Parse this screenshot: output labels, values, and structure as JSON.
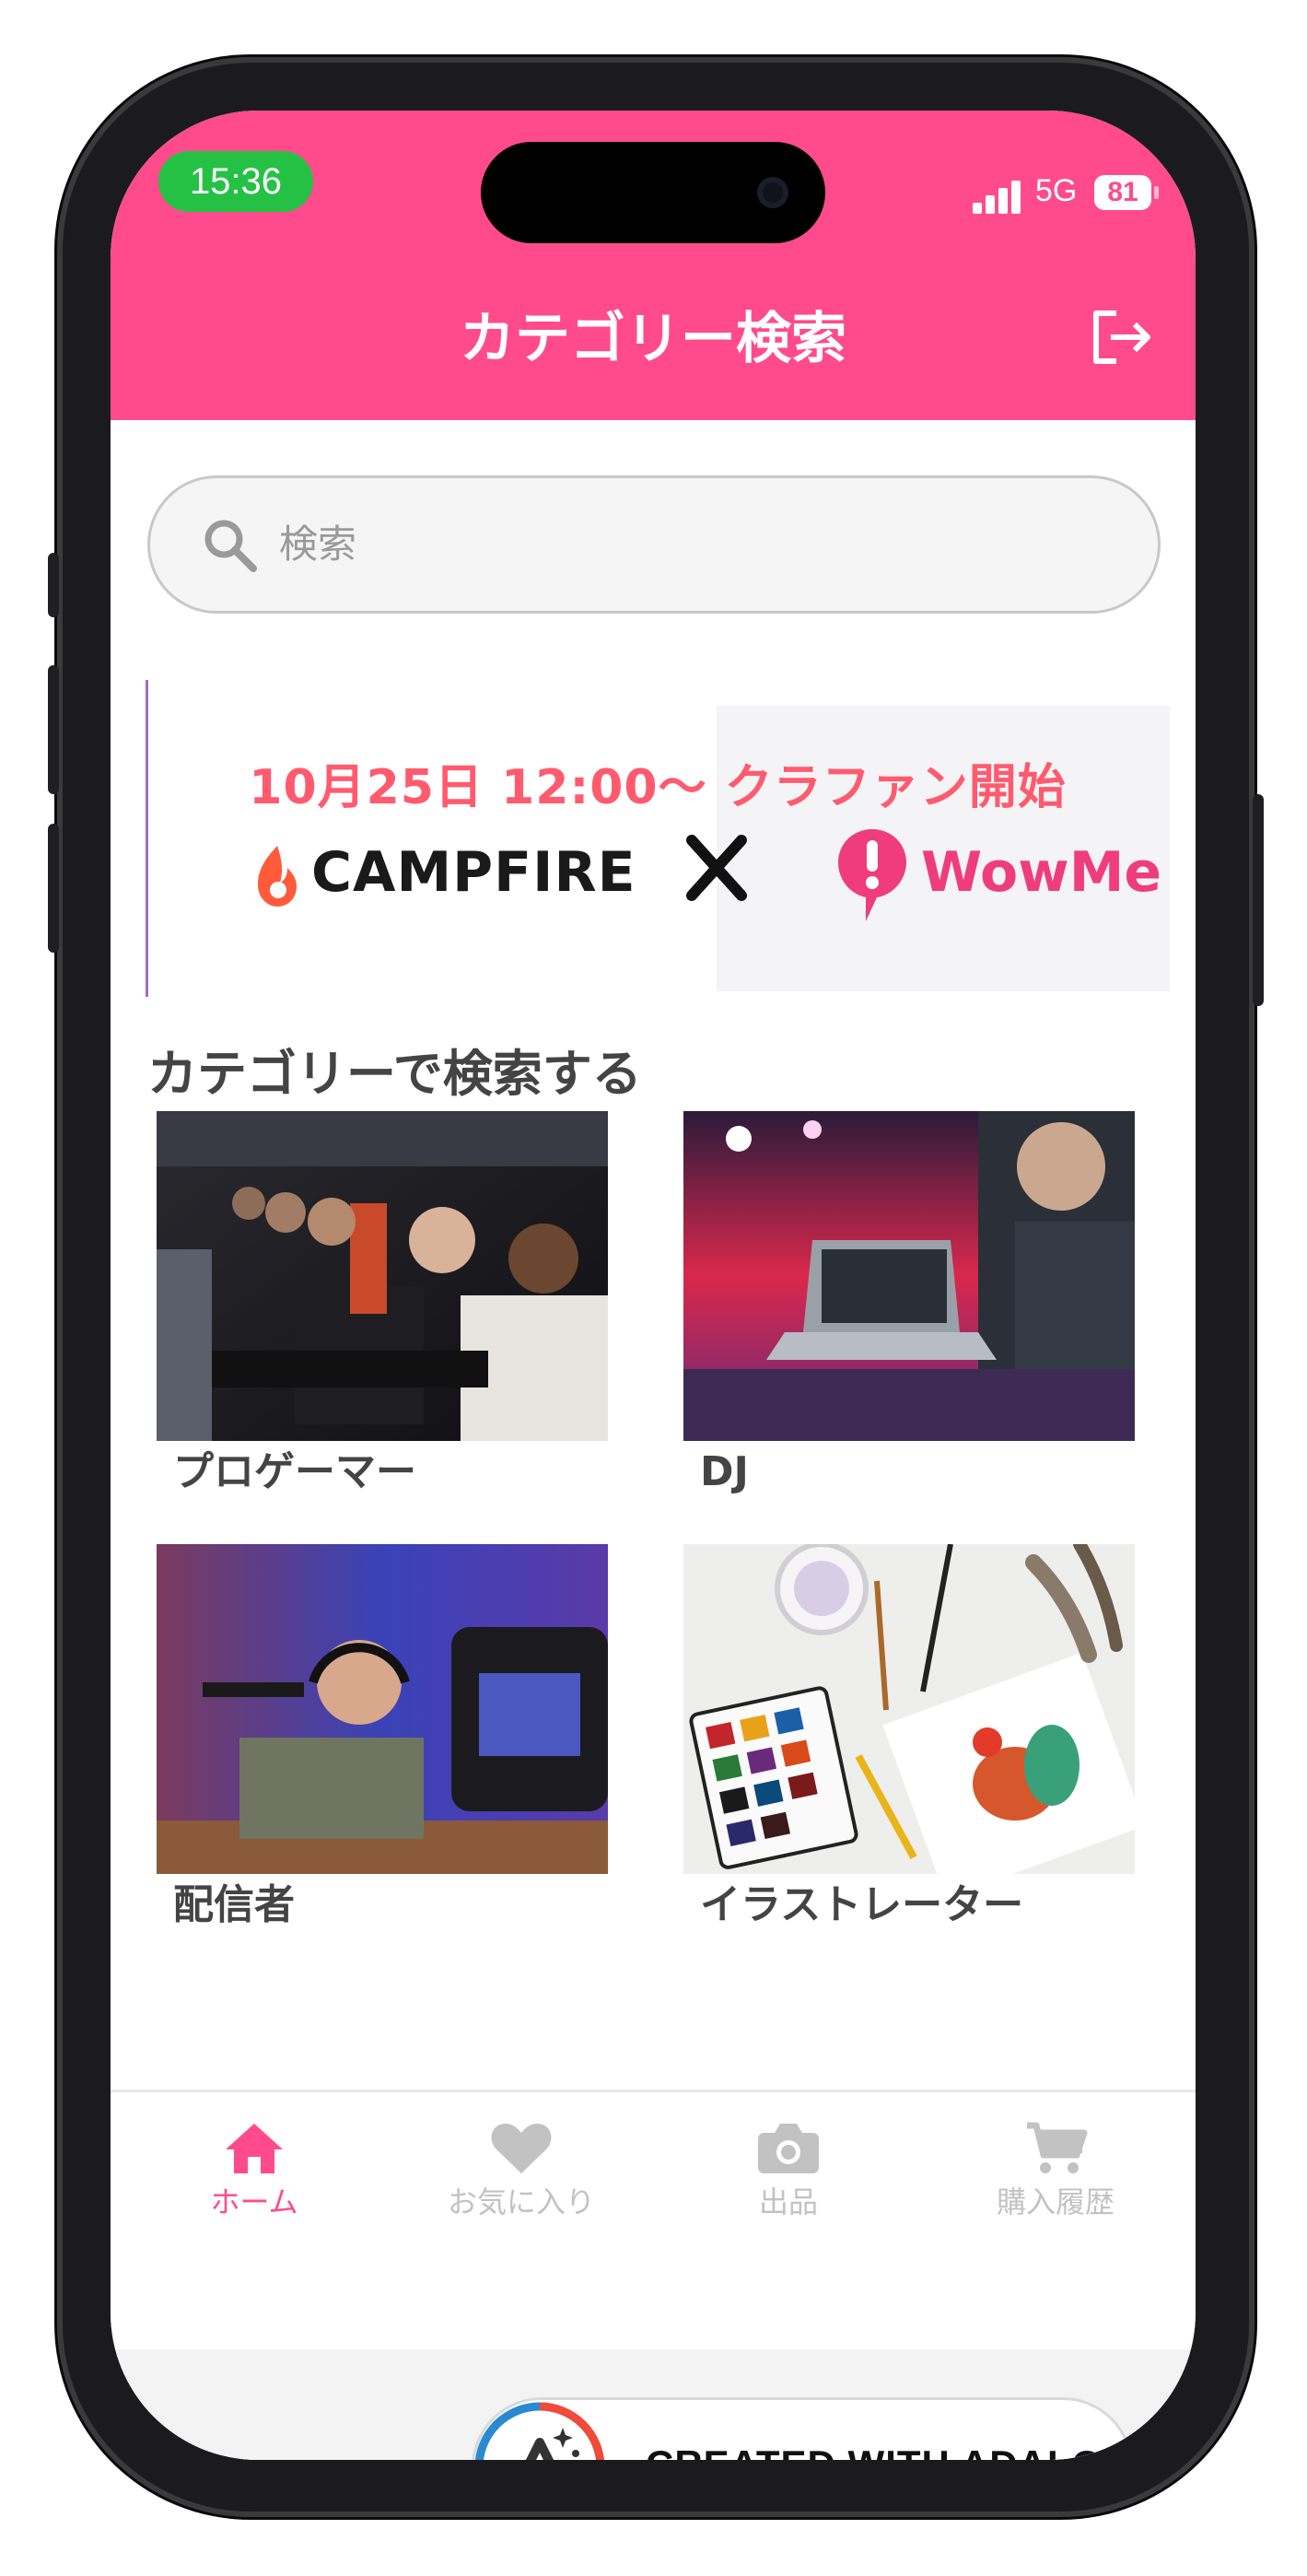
{
  "status_bar": {
    "time": "15:36",
    "network": "5G",
    "battery": "81"
  },
  "header": {
    "title": "カテゴリー検索"
  },
  "search": {
    "placeholder": "検索"
  },
  "banner": {
    "date_line": "10月25日 12:00〜 クラファン開始",
    "brand_left": "CAMPFIRE",
    "brand_right": "WowMe"
  },
  "section": {
    "title": "カテゴリーで検索する"
  },
  "categories": [
    {
      "label": "プロゲーマー"
    },
    {
      "label": "DJ"
    },
    {
      "label": "配信者"
    },
    {
      "label": "イラストレーター"
    }
  ],
  "tabbar": {
    "items": [
      {
        "label": "ホーム",
        "icon": "home-icon",
        "active": true
      },
      {
        "label": "お気に入り",
        "icon": "heart-icon",
        "active": false
      },
      {
        "label": "出品",
        "icon": "camera-icon",
        "active": false
      },
      {
        "label": "購入履歴",
        "icon": "cart-icon",
        "active": false
      }
    ],
    "active_color": "#ff4b8b",
    "inactive_color": "#c2c2c2"
  },
  "footer": {
    "adalo_label": "CREATED WITH ADALO"
  },
  "colors": {
    "accent": "#ff4b8b",
    "status_pill": "#25c144"
  }
}
